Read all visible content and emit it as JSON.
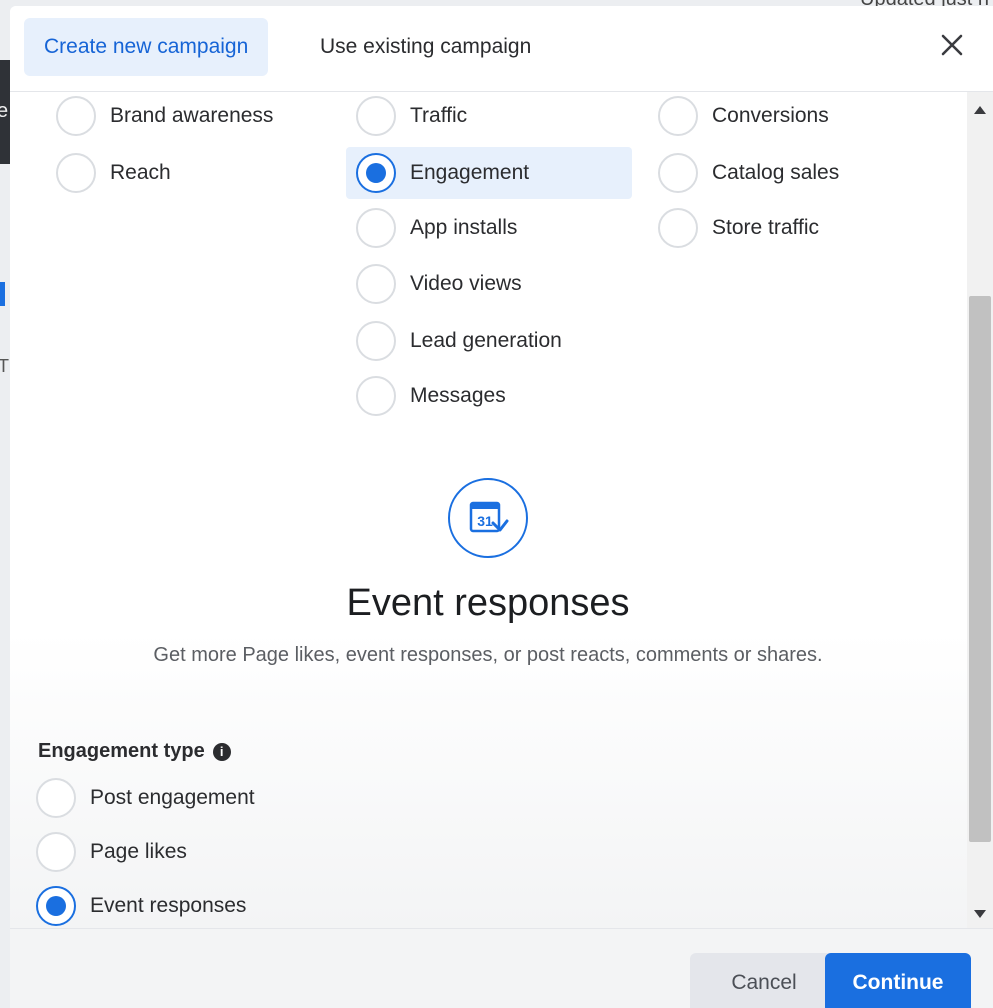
{
  "background": {
    "top_text": "Updated just n",
    "left_char": "e",
    "left_char2": "T"
  },
  "header": {
    "tabs": [
      {
        "label": "Create new campaign",
        "active": true
      },
      {
        "label": "Use existing campaign",
        "active": false
      }
    ],
    "close_icon": "close-icon"
  },
  "objectives": {
    "selected": "Engagement",
    "items": [
      {
        "label": "Brand awareness"
      },
      {
        "label": "Reach"
      },
      {
        "label": "Traffic"
      },
      {
        "label": "Engagement"
      },
      {
        "label": "App installs"
      },
      {
        "label": "Video views"
      },
      {
        "label": "Lead generation"
      },
      {
        "label": "Messages"
      },
      {
        "label": "Conversions"
      },
      {
        "label": "Catalog sales"
      },
      {
        "label": "Store traffic"
      }
    ]
  },
  "detail": {
    "icon": "calendar-event-icon",
    "icon_text": "31",
    "title": "Event responses",
    "description": "Get more Page likes, event responses, or post reacts, comments or shares."
  },
  "engagement_type": {
    "label": "Engagement type",
    "info_icon": "info-icon",
    "selected": "Event responses",
    "options": [
      {
        "label": "Post engagement"
      },
      {
        "label": "Page likes"
      },
      {
        "label": "Event responses"
      }
    ]
  },
  "footer": {
    "cancel_label": "Cancel",
    "continue_label": "Continue"
  },
  "colors": {
    "accent": "#1a6fe0",
    "tab_active_bg": "#e7f0fc",
    "tab_active_text": "#1664d6"
  }
}
